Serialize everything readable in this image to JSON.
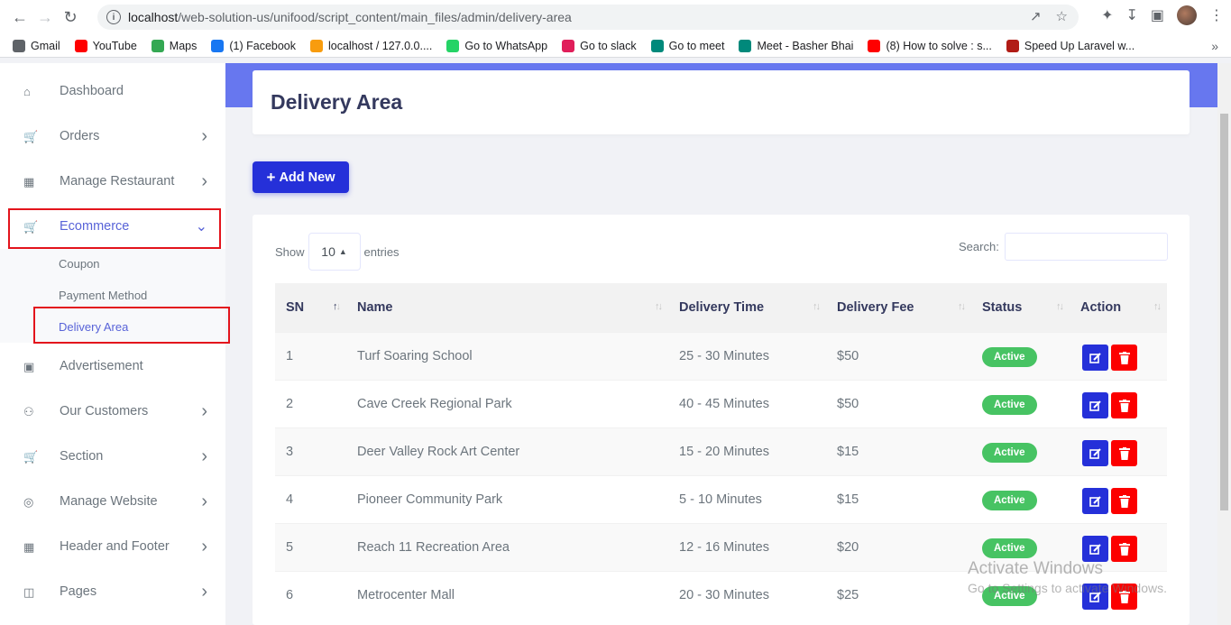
{
  "browser": {
    "url_host": "localhost",
    "url_path": "/web-solution-us/unifood/script_content/main_files/admin/delivery-area",
    "bookmarks": [
      {
        "label": "Gmail",
        "icon": "google-icon",
        "color": "#5f6368"
      },
      {
        "label": "YouTube",
        "icon": "youtube-icon",
        "color": "#ff0000"
      },
      {
        "label": "Maps",
        "icon": "maps-icon",
        "color": "#34a853"
      },
      {
        "label": "(1) Facebook",
        "icon": "facebook-icon",
        "color": "#1877f2"
      },
      {
        "label": "localhost / 127.0.0....",
        "icon": "phpmyadmin-icon",
        "color": "#f89c0e"
      },
      {
        "label": "Go to WhatsApp",
        "icon": "whatsapp-icon",
        "color": "#25d366"
      },
      {
        "label": "Go to slack",
        "icon": "slack-icon",
        "color": "#e01e5a"
      },
      {
        "label": "Go to meet",
        "icon": "meet-icon",
        "color": "#00897b"
      },
      {
        "label": "Meet - Basher Bhai",
        "icon": "meet-icon",
        "color": "#00897b"
      },
      {
        "label": "(8) How to solve : s...",
        "icon": "youtube-icon",
        "color": "#ff0000"
      },
      {
        "label": "Speed Up Laravel w...",
        "icon": "laravel-icon",
        "color": "#b11c16"
      }
    ]
  },
  "sidebar": {
    "items": [
      {
        "label": "Dashboard",
        "icon": "home-icon",
        "has_chevron": false
      },
      {
        "label": "Orders",
        "icon": "cart-icon",
        "has_chevron": true
      },
      {
        "label": "Manage Restaurant",
        "icon": "grid-icon",
        "has_chevron": true
      },
      {
        "label": "Ecommerce",
        "icon": "cart-icon",
        "has_chevron": true,
        "active": true
      },
      {
        "label": "Advertisement",
        "icon": "ad-icon",
        "has_chevron": false
      },
      {
        "label": "Our Customers",
        "icon": "users-icon",
        "has_chevron": true
      },
      {
        "label": "Section",
        "icon": "cart-icon",
        "has_chevron": true
      },
      {
        "label": "Manage Website",
        "icon": "globe-icon",
        "has_chevron": true
      },
      {
        "label": "Header and Footer",
        "icon": "grid-icon",
        "has_chevron": true
      },
      {
        "label": "Pages",
        "icon": "columns-icon",
        "has_chevron": true
      }
    ],
    "submenu": [
      {
        "label": "Coupon"
      },
      {
        "label": "Payment Method"
      },
      {
        "label": "Delivery Area",
        "active": true
      }
    ]
  },
  "page": {
    "title": "Delivery Area",
    "add_button": "Add New"
  },
  "table_controls": {
    "show_label": "Show",
    "entries_value": "10",
    "entries_label": "entries",
    "search_label": "Search:"
  },
  "table": {
    "columns": [
      "SN",
      "Name",
      "Delivery Time",
      "Delivery Fee",
      "Status",
      "Action"
    ],
    "rows": [
      {
        "sn": "1",
        "name": "Turf Soaring School",
        "time": "25 - 30 Minutes",
        "fee": "$50",
        "status": "Active"
      },
      {
        "sn": "2",
        "name": "Cave Creek Regional Park",
        "time": "40 - 45 Minutes",
        "fee": "$50",
        "status": "Active"
      },
      {
        "sn": "3",
        "name": "Deer Valley Rock Art Center",
        "time": "15 - 20 Minutes",
        "fee": "$15",
        "status": "Active"
      },
      {
        "sn": "4",
        "name": "Pioneer Community Park",
        "time": "5 - 10 Minutes",
        "fee": "$15",
        "status": "Active"
      },
      {
        "sn": "5",
        "name": "Reach 11 Recreation Area",
        "time": "12 - 16 Minutes",
        "fee": "$20",
        "status": "Active"
      },
      {
        "sn": "6",
        "name": "Metrocenter Mall",
        "time": "20 - 30 Minutes",
        "fee": "$25",
        "status": "Active"
      }
    ]
  },
  "watermark": {
    "line1": "Activate Windows",
    "line2": "Go to Settings to activate Windows."
  },
  "colors": {
    "accent": "#6777ef",
    "primary_button": "#2530d9",
    "active_badge": "#47c363",
    "delete_button": "#fc0000",
    "highlight_box": "#e3141c"
  }
}
